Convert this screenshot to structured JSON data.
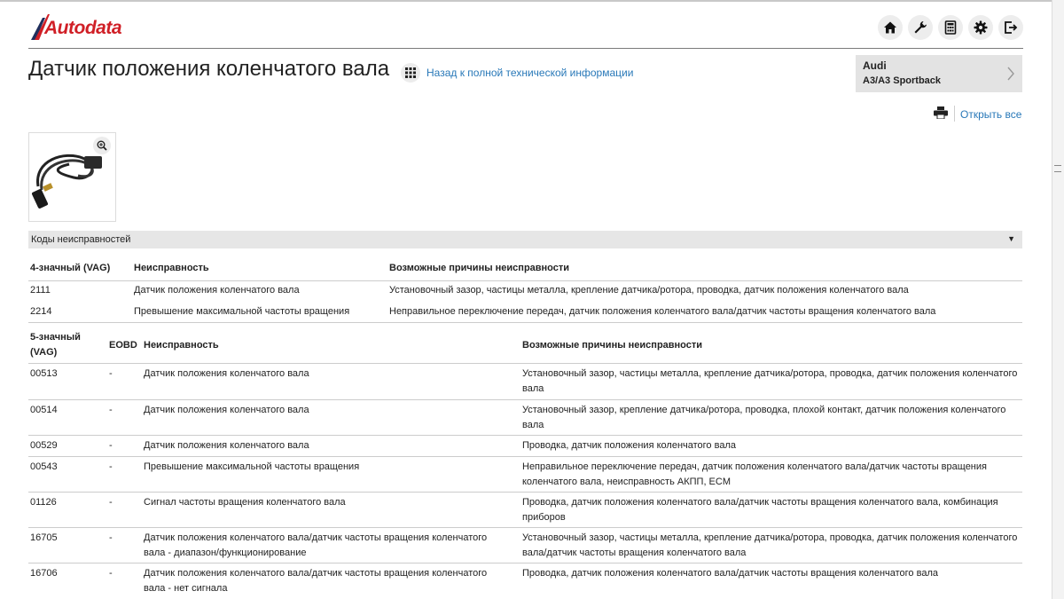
{
  "header": {
    "logo_text": "Autodata",
    "toolbar": [
      {
        "name": "home-icon"
      },
      {
        "name": "wrench-icon"
      },
      {
        "name": "calculator-icon"
      },
      {
        "name": "gear-icon"
      },
      {
        "name": "logout-icon"
      }
    ]
  },
  "page": {
    "title": "Датчик положения коленчатого вала",
    "back_link": "Назад к полной технической информации",
    "open_all": "Открыть все"
  },
  "vehicle": {
    "make": "Audi",
    "model": "A3/A3 Sportback"
  },
  "section": {
    "label": "Коды неисправностей"
  },
  "table4": {
    "headers": [
      "4-значный (VAG)",
      "Неисправность",
      "Возможные причины неисправности"
    ],
    "rows": [
      {
        "code": "2111",
        "fault": "Датчик положения коленчатого вала",
        "causes": "Установочный зазор, частицы металла, крепление датчика/ротора, проводка, датчик положения коленчатого вала"
      },
      {
        "code": "2214",
        "fault": "Превышение максимальной частоты вращения",
        "causes": "Неправильное переключение передач, датчик положения коленчатого вала/датчик частоты вращения коленчатого вала"
      }
    ]
  },
  "table5": {
    "headers": [
      "5-значный (VAG)",
      "EOBD",
      "Неисправность",
      "Возможные причины неисправности"
    ],
    "rows": [
      {
        "code": "00513",
        "eobd": "-",
        "fault": "Датчик положения коленчатого вала",
        "causes": "Установочный зазор, частицы металла, крепление датчика/ротора, проводка, датчик положения коленчатого вала"
      },
      {
        "code": "00514",
        "eobd": "-",
        "fault": "Датчик положения коленчатого вала",
        "causes": "Установочный зазор, крепление датчика/ротора, проводка, плохой контакт, датчик положения коленчатого вала"
      },
      {
        "code": "00529",
        "eobd": "-",
        "fault": "Датчик положения коленчатого вала",
        "causes": "Проводка, датчик положения коленчатого вала"
      },
      {
        "code": "00543",
        "eobd": "-",
        "fault": "Превышение максимальной частоты вращения",
        "causes": "Неправильное переключение передач, датчик положения коленчатого вала/датчик частоты вращения коленчатого вала, неисправность АКПП, ECM"
      },
      {
        "code": "01126",
        "eobd": "-",
        "fault": "Сигнал частоты вращения коленчатого вала",
        "causes": "Проводка, датчик положения коленчатого вала/датчик частоты вращения коленчатого вала, комбинация приборов"
      },
      {
        "code": "16705",
        "eobd": "-",
        "fault": "Датчик положения коленчатого вала/датчик частоты вращения коленчатого вала - диапазон/функционирование",
        "causes": "Установочный зазор, частицы металла, крепление датчика/ротора, проводка, датчик положения коленчатого вала/датчик частоты вращения коленчатого вала"
      },
      {
        "code": "16706",
        "eobd": "-",
        "fault": "Датчик положения коленчатого вала/датчик частоты вращения коленчатого вала - нет сигнала",
        "causes": "Проводка, датчик положения коленчатого вала/датчик частоты вращения коленчатого вала"
      }
    ]
  },
  "colors": {
    "brand": "#d01f26",
    "link": "#2878b8"
  }
}
